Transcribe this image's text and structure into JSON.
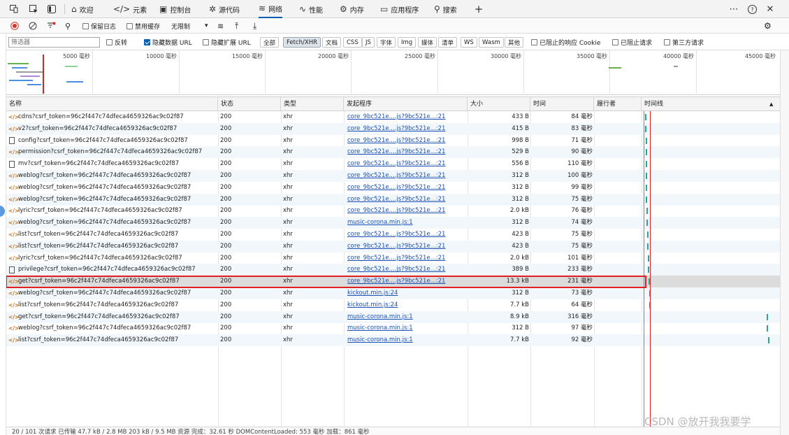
{
  "tabs": [
    {
      "label": "欢迎",
      "icon": "home-icon"
    },
    {
      "label": "元素",
      "icon": "code-icon"
    },
    {
      "label": "控制台",
      "icon": "console-icon"
    },
    {
      "label": "源代码",
      "icon": "bug-icon"
    },
    {
      "label": "网络",
      "icon": "wifi-icon",
      "active": true
    },
    {
      "label": "性能",
      "icon": "performance-icon"
    },
    {
      "label": "内存",
      "icon": "memory-icon"
    },
    {
      "label": "应用程序",
      "icon": "application-icon"
    },
    {
      "label": "搜索",
      "icon": "search-icon"
    }
  ],
  "toolbar": {
    "preserve_log": "保留日志",
    "disable_cache": "禁用缓存",
    "throttle": "无限制"
  },
  "filter": {
    "placeholder": "筛选器",
    "invert": "反转",
    "hide_data_urls": "隐藏数据 URL",
    "hide_extension_urls": "隐藏扩展 URL",
    "types": [
      "全部",
      "Fetch/XHR",
      "文档",
      "CSS",
      "JS",
      "字体",
      "Img",
      "媒体",
      "清单",
      "WS",
      "Wasm",
      "其他"
    ],
    "active_type": "Fetch/XHR",
    "blocked_cookies": "已阻止的响应 Cookie",
    "blocked_requests": "已阻止请求",
    "third_party": "第三方请求"
  },
  "overview": {
    "ticks": [
      "5000 毫秒",
      "10000 毫秒",
      "15000 毫秒",
      "20000 毫秒",
      "25000 毫秒",
      "30000 毫秒",
      "35000 毫秒",
      "40000 毫秒",
      "45000 毫秒"
    ]
  },
  "columns": [
    "名称",
    "状态",
    "类型",
    "发起程序",
    "大小",
    "时间",
    "履行者",
    "时间线"
  ],
  "sort_indicator": "▲",
  "rows": [
    {
      "name": "cdns?csrf_token=96c2f447c74dfeca4659326ac9c02f87",
      "icon": "xhr",
      "status": "200",
      "type": "xhr",
      "initiator": "core_9bc521e....js?9bc521e...:21",
      "size": "433 B",
      "time": "84 毫秒"
    },
    {
      "name": "v2?csrf_token=96c2f447c74dfeca4659326ac9c02f87",
      "icon": "xhr",
      "status": "200",
      "type": "xhr",
      "initiator": "core_9bc521e....js?9bc521e...:21",
      "size": "415 B",
      "time": "83 毫秒"
    },
    {
      "name": "config?csrf_token=96c2f447c74dfeca4659326ac9c02f87",
      "icon": "doc",
      "status": "200",
      "type": "xhr",
      "initiator": "core_9bc521e....js?9bc521e...:21",
      "size": "998 B",
      "time": "71 毫秒"
    },
    {
      "name": "permission?csrf_token=96c2f447c74dfeca4659326ac9c02f87",
      "icon": "xhr",
      "status": "200",
      "type": "xhr",
      "initiator": "core_9bc521e....js?9bc521e...:21",
      "size": "529 B",
      "time": "90 毫秒"
    },
    {
      "name": "mv?csrf_token=96c2f447c74dfeca4659326ac9c02f87",
      "icon": "doc",
      "status": "200",
      "type": "xhr",
      "initiator": "core_9bc521e....js?9bc521e...:21",
      "size": "556 B",
      "time": "110 毫秒"
    },
    {
      "name": "weblog?csrf_token=96c2f447c74dfeca4659326ac9c02f87",
      "icon": "xhr",
      "status": "200",
      "type": "xhr",
      "initiator": "core_9bc521e....js?9bc521e...:21",
      "size": "312 B",
      "time": "100 毫秒"
    },
    {
      "name": "weblog?csrf_token=96c2f447c74dfeca4659326ac9c02f87",
      "icon": "xhr",
      "status": "200",
      "type": "xhr",
      "initiator": "core_9bc521e....js?9bc521e...:21",
      "size": "312 B",
      "time": "99 毫秒"
    },
    {
      "name": "weblog?csrf_token=96c2f447c74dfeca4659326ac9c02f87",
      "icon": "xhr",
      "status": "200",
      "type": "xhr",
      "initiator": "core_9bc521e....js?9bc521e...:21",
      "size": "312 B",
      "time": "75 毫秒"
    },
    {
      "name": "lyric?csrf_token=96c2f447c74dfeca4659326ac9c02f87",
      "icon": "xhr",
      "status": "200",
      "type": "xhr",
      "initiator": "core_9bc521e....js?9bc521e...:21",
      "size": "2.0 kB",
      "time": "76 毫秒"
    },
    {
      "name": "weblog?csrf_token=96c2f447c74dfeca4659326ac9c02f87",
      "icon": "xhr",
      "status": "200",
      "type": "xhr",
      "initiator": "music-corona.min.js:1",
      "size": "312 B",
      "time": "74 毫秒"
    },
    {
      "name": "list?csrf_token=96c2f447c74dfeca4659326ac9c02f87",
      "icon": "xhr",
      "status": "200",
      "type": "xhr",
      "initiator": "core_9bc521e....js?9bc521e...:21",
      "size": "423 B",
      "time": "75 毫秒"
    },
    {
      "name": "list?csrf_token=96c2f447c74dfeca4659326ac9c02f87",
      "icon": "xhr",
      "status": "200",
      "type": "xhr",
      "initiator": "core_9bc521e....js?9bc521e...:21",
      "size": "423 B",
      "time": "75 毫秒"
    },
    {
      "name": "lyric?csrf_token=96c2f447c74dfeca4659326ac9c02f87",
      "icon": "xhr",
      "status": "200",
      "type": "xhr",
      "initiator": "core_9bc521e....js?9bc521e...:21",
      "size": "2.0 kB",
      "time": "101 毫秒"
    },
    {
      "name": "privilege?csrf_token=96c2f447c74dfeca4659326ac9c02f87",
      "icon": "doc",
      "status": "200",
      "type": "xhr",
      "initiator": "core_9bc521e....js?9bc521e...:21",
      "size": "389 B",
      "time": "233 毫秒"
    },
    {
      "name": "get?csrf_token=96c2f447c74dfeca4659326ac9c02f87",
      "icon": "xhr",
      "status": "200",
      "type": "xhr",
      "initiator": "core_9bc521e....js?9bc521e...:21",
      "size": "13.3 kB",
      "time": "231 毫秒",
      "selected": true
    },
    {
      "name": "weblog?csrf_token=96c2f447c74dfeca4659326ac9c02f87",
      "icon": "xhr",
      "status": "200",
      "type": "xhr",
      "initiator": "kickout.min.js:24",
      "size": "312 B",
      "time": "73 毫秒"
    },
    {
      "name": "list?csrf_token=96c2f447c74dfeca4659326ac9c02f87",
      "icon": "xhr",
      "status": "200",
      "type": "xhr",
      "initiator": "kickout.min.js:24",
      "size": "7.7 kB",
      "time": "64 毫秒"
    },
    {
      "name": "get?csrf_token=96c2f447c74dfeca4659326ac9c02f87",
      "icon": "xhr",
      "status": "200",
      "type": "xhr",
      "initiator": "music-corona.min.js:1",
      "size": "8.9 kB",
      "time": "316 毫秒"
    },
    {
      "name": "weblog?csrf_token=96c2f447c74dfeca4659326ac9c02f87",
      "icon": "xhr",
      "status": "200",
      "type": "xhr",
      "initiator": "music-corona.min.js:1",
      "size": "312 B",
      "time": "97 毫秒"
    },
    {
      "name": "list?csrf_token=96c2f447c74dfeca4659326ac9c02f87",
      "icon": "xhr",
      "status": "200",
      "type": "xhr",
      "initiator": "music-corona.min.js:1",
      "size": "7.7 kB",
      "time": "92 毫秒"
    }
  ],
  "statusbar": {
    "summary": "20 / 101 次请求  已传输 47.7 kB / 2.8 MB  203 kB / 9.5 MB 资源  完成：32.61 秒  DOMContentLoaded: 553 毫秒  加载：861 毫秒"
  },
  "watermark": "CSDN @放开我我要学",
  "colors": {
    "accent": "#0a5fb4",
    "highlight": "#e02020",
    "initiator_link": "#1a4fb5",
    "xhr_icon": "#c8731a"
  }
}
